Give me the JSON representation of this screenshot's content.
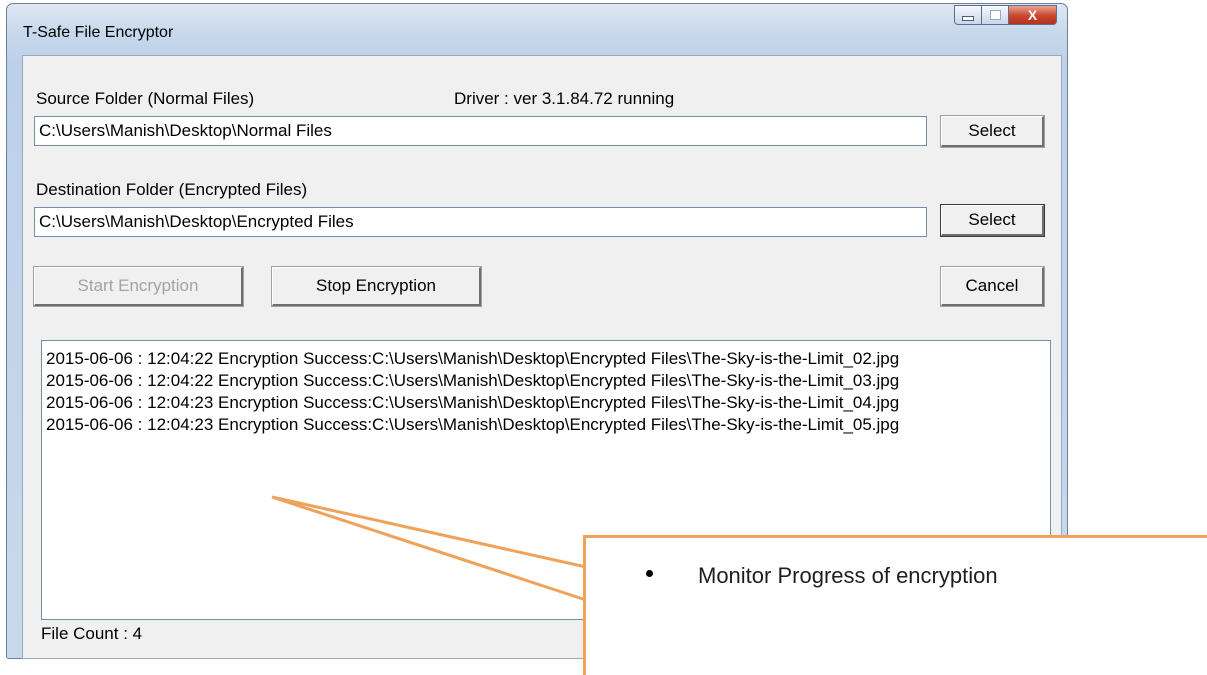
{
  "window": {
    "title": "T-Safe File Encryptor",
    "close_glyph": "X"
  },
  "source": {
    "label": "Source Folder (Normal Files)",
    "value": "C:\\Users\\Manish\\Desktop\\Normal Files",
    "select_label": "Select"
  },
  "driver_status": "Driver : ver 3.1.84.72 running",
  "destination": {
    "label": "Destination Folder (Encrypted Files)",
    "value": "C:\\Users\\Manish\\Desktop\\Encrypted Files",
    "select_label": "Select"
  },
  "buttons": {
    "start": "Start Encryption",
    "stop": "Stop Encryption",
    "cancel": "Cancel"
  },
  "log": [
    "2015-06-06 : 12:04:22 Encryption Success:C:\\Users\\Manish\\Desktop\\Encrypted Files\\The-Sky-is-the-Limit_02.jpg",
    "2015-06-06 : 12:04:22 Encryption Success:C:\\Users\\Manish\\Desktop\\Encrypted Files\\The-Sky-is-the-Limit_03.jpg",
    "2015-06-06 : 12:04:23 Encryption Success:C:\\Users\\Manish\\Desktop\\Encrypted Files\\The-Sky-is-the-Limit_04.jpg",
    "2015-06-06 : 12:04:23 Encryption Success:C:\\Users\\Manish\\Desktop\\Encrypted Files\\The-Sky-is-the-Limit_05.jpg"
  ],
  "status": "File Count : 4",
  "callout": {
    "text": "Monitor Progress of encryption",
    "color": "#f0a25a"
  }
}
